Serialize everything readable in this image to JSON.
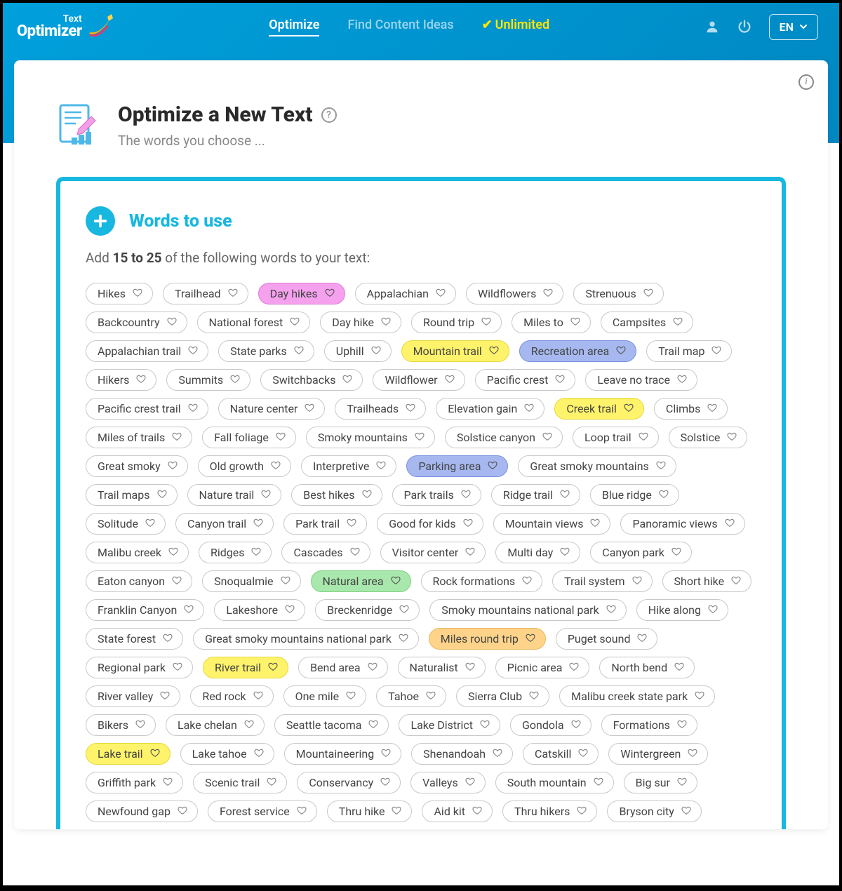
{
  "header": {
    "logo": {
      "top": "Text",
      "bottom": "Optimizer"
    },
    "nav": {
      "optimize": "Optimize",
      "find_ideas": "Find Content Ideas",
      "unlimited": "Unlimited"
    },
    "lang": "EN"
  },
  "page": {
    "title": "Optimize a New Text",
    "subtitle": "The words you choose ..."
  },
  "words_panel": {
    "heading": "Words to use",
    "instr_prefix": "Add ",
    "instr_bold": "15 to 25",
    "instr_suffix": " of the following words to your text:"
  },
  "pills": [
    {
      "t": "Hikes",
      "c": ""
    },
    {
      "t": "Trailhead",
      "c": ""
    },
    {
      "t": "Day hikes",
      "c": "pink"
    },
    {
      "t": "Appalachian",
      "c": ""
    },
    {
      "t": "Wildflowers",
      "c": ""
    },
    {
      "t": "Strenuous",
      "c": ""
    },
    {
      "t": "Backcountry",
      "c": ""
    },
    {
      "t": "National forest",
      "c": ""
    },
    {
      "t": "Day hike",
      "c": ""
    },
    {
      "t": "Round trip",
      "c": ""
    },
    {
      "t": "Miles to",
      "c": ""
    },
    {
      "t": "Campsites",
      "c": ""
    },
    {
      "t": "Appalachian trail",
      "c": ""
    },
    {
      "t": "State parks",
      "c": ""
    },
    {
      "t": "Uphill",
      "c": ""
    },
    {
      "t": "Mountain trail",
      "c": "yellow"
    },
    {
      "t": "Recreation area",
      "c": "blue"
    },
    {
      "t": "Trail map",
      "c": ""
    },
    {
      "t": "Hikers",
      "c": ""
    },
    {
      "t": "Summits",
      "c": ""
    },
    {
      "t": "Switchbacks",
      "c": ""
    },
    {
      "t": "Wildflower",
      "c": ""
    },
    {
      "t": "Pacific crest",
      "c": ""
    },
    {
      "t": "Leave no trace",
      "c": ""
    },
    {
      "t": "Pacific crest trail",
      "c": ""
    },
    {
      "t": "Nature center",
      "c": ""
    },
    {
      "t": "Trailheads",
      "c": ""
    },
    {
      "t": "Elevation gain",
      "c": ""
    },
    {
      "t": "Creek trail",
      "c": "yellow"
    },
    {
      "t": "Climbs",
      "c": ""
    },
    {
      "t": "Miles of trails",
      "c": ""
    },
    {
      "t": "Fall foliage",
      "c": ""
    },
    {
      "t": "Smoky mountains",
      "c": ""
    },
    {
      "t": "Solstice canyon",
      "c": ""
    },
    {
      "t": "Loop trail",
      "c": ""
    },
    {
      "t": "Solstice",
      "c": ""
    },
    {
      "t": "Great smoky",
      "c": ""
    },
    {
      "t": "Old growth",
      "c": ""
    },
    {
      "t": "Interpretive",
      "c": ""
    },
    {
      "t": "Parking area",
      "c": "blue"
    },
    {
      "t": "Great smoky mountains",
      "c": ""
    },
    {
      "t": "Trail maps",
      "c": ""
    },
    {
      "t": "Nature trail",
      "c": ""
    },
    {
      "t": "Best hikes",
      "c": ""
    },
    {
      "t": "Park trails",
      "c": ""
    },
    {
      "t": "Ridge trail",
      "c": ""
    },
    {
      "t": "Blue ridge",
      "c": ""
    },
    {
      "t": "Solitude",
      "c": ""
    },
    {
      "t": "Canyon trail",
      "c": ""
    },
    {
      "t": "Park trail",
      "c": ""
    },
    {
      "t": "Good for kids",
      "c": ""
    },
    {
      "t": "Mountain views",
      "c": ""
    },
    {
      "t": "Panoramic views",
      "c": ""
    },
    {
      "t": "Malibu creek",
      "c": ""
    },
    {
      "t": "Ridges",
      "c": ""
    },
    {
      "t": "Cascades",
      "c": ""
    },
    {
      "t": "Visitor center",
      "c": ""
    },
    {
      "t": "Multi day",
      "c": ""
    },
    {
      "t": "Canyon park",
      "c": ""
    },
    {
      "t": "Eaton canyon",
      "c": ""
    },
    {
      "t": "Snoqualmie",
      "c": ""
    },
    {
      "t": "Natural area",
      "c": "green"
    },
    {
      "t": "Rock formations",
      "c": ""
    },
    {
      "t": "Trail system",
      "c": ""
    },
    {
      "t": "Short hike",
      "c": ""
    },
    {
      "t": "Franklin Canyon",
      "c": ""
    },
    {
      "t": "Lakeshore",
      "c": ""
    },
    {
      "t": "Breckenridge",
      "c": ""
    },
    {
      "t": "Smoky mountains national park",
      "c": ""
    },
    {
      "t": "Hike along",
      "c": ""
    },
    {
      "t": "State forest",
      "c": ""
    },
    {
      "t": "Great smoky mountains national park",
      "c": ""
    },
    {
      "t": "Miles round trip",
      "c": "orange"
    },
    {
      "t": "Puget sound",
      "c": ""
    },
    {
      "t": "Regional park",
      "c": ""
    },
    {
      "t": "River trail",
      "c": "yellow"
    },
    {
      "t": "Bend area",
      "c": ""
    },
    {
      "t": "Naturalist",
      "c": ""
    },
    {
      "t": "Picnic area",
      "c": ""
    },
    {
      "t": "North bend",
      "c": ""
    },
    {
      "t": "River valley",
      "c": ""
    },
    {
      "t": "Red rock",
      "c": ""
    },
    {
      "t": "One mile",
      "c": ""
    },
    {
      "t": "Tahoe",
      "c": ""
    },
    {
      "t": "Sierra Club",
      "c": ""
    },
    {
      "t": "Malibu creek state park",
      "c": ""
    },
    {
      "t": "Bikers",
      "c": ""
    },
    {
      "t": "Lake chelan",
      "c": ""
    },
    {
      "t": "Seattle tacoma",
      "c": ""
    },
    {
      "t": "Lake District",
      "c": ""
    },
    {
      "t": "Gondola",
      "c": ""
    },
    {
      "t": "Formations",
      "c": ""
    },
    {
      "t": "Lake trail",
      "c": "yellow"
    },
    {
      "t": "Lake tahoe",
      "c": ""
    },
    {
      "t": "Mountaineering",
      "c": ""
    },
    {
      "t": "Shenandoah",
      "c": ""
    },
    {
      "t": "Catskill",
      "c": ""
    },
    {
      "t": "Wintergreen",
      "c": ""
    },
    {
      "t": "Griffith park",
      "c": ""
    },
    {
      "t": "Scenic trail",
      "c": ""
    },
    {
      "t": "Conservancy",
      "c": ""
    },
    {
      "t": "Valleys",
      "c": ""
    },
    {
      "t": "South mountain",
      "c": ""
    },
    {
      "t": "Big sur",
      "c": ""
    },
    {
      "t": "Newfound gap",
      "c": ""
    },
    {
      "t": "Forest service",
      "c": ""
    },
    {
      "t": "Thru hike",
      "c": ""
    },
    {
      "t": "Aid kit",
      "c": ""
    },
    {
      "t": "Thru hikers",
      "c": ""
    },
    {
      "t": "Bryson city",
      "c": ""
    }
  ]
}
